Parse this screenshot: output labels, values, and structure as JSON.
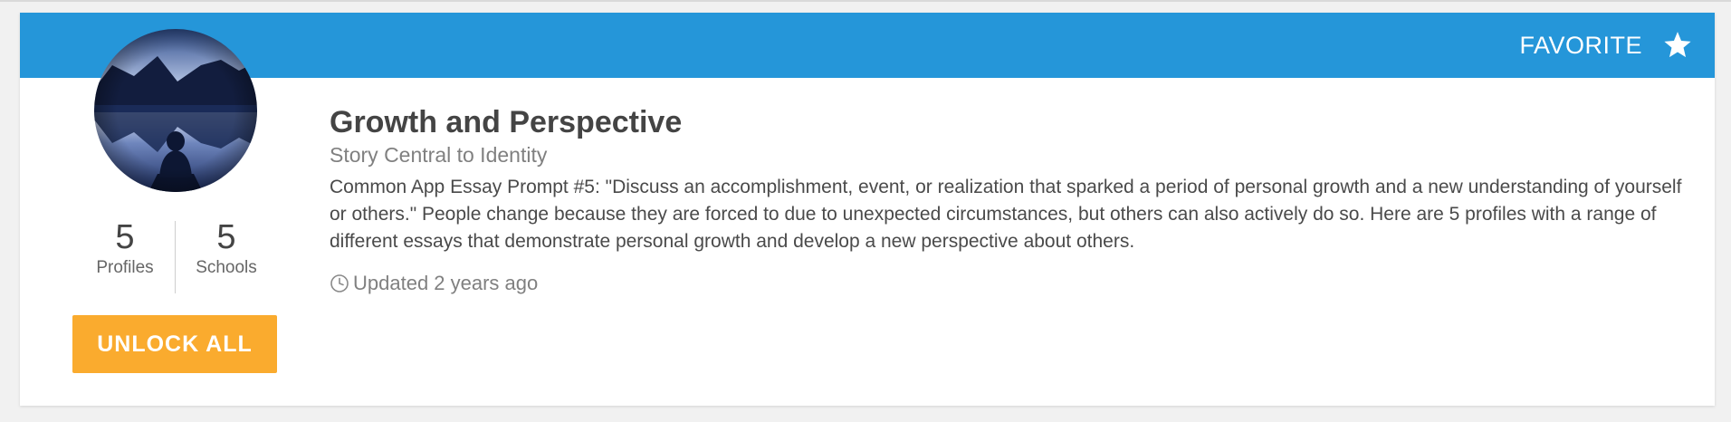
{
  "header": {
    "favorite_label": "FAVORITE",
    "favorite_icon": "star-icon",
    "banner_color": "#2596d9"
  },
  "collection": {
    "avatar_image": "lake-mountain-reflection",
    "title": "Growth and Perspective",
    "subtitle": "Story Central to Identity",
    "description": "Common App Essay Prompt #5: \"Discuss an accomplishment, event, or realization that sparked a period of personal growth and a new understanding of yourself or others.\" People change because they are forced to due to unexpected circumstances, but others can also actively do so. Here are 5 profiles with a range of different essays that demonstrate personal growth and develop a new perspective about others.",
    "updated_icon": "clock-icon",
    "updated": "Updated 2 years ago"
  },
  "stats": [
    {
      "value": "5",
      "label": "Profiles"
    },
    {
      "value": "5",
      "label": "Schools"
    }
  ],
  "actions": {
    "unlock_label": "UNLOCK ALL",
    "unlock_color": "#faab2e"
  }
}
